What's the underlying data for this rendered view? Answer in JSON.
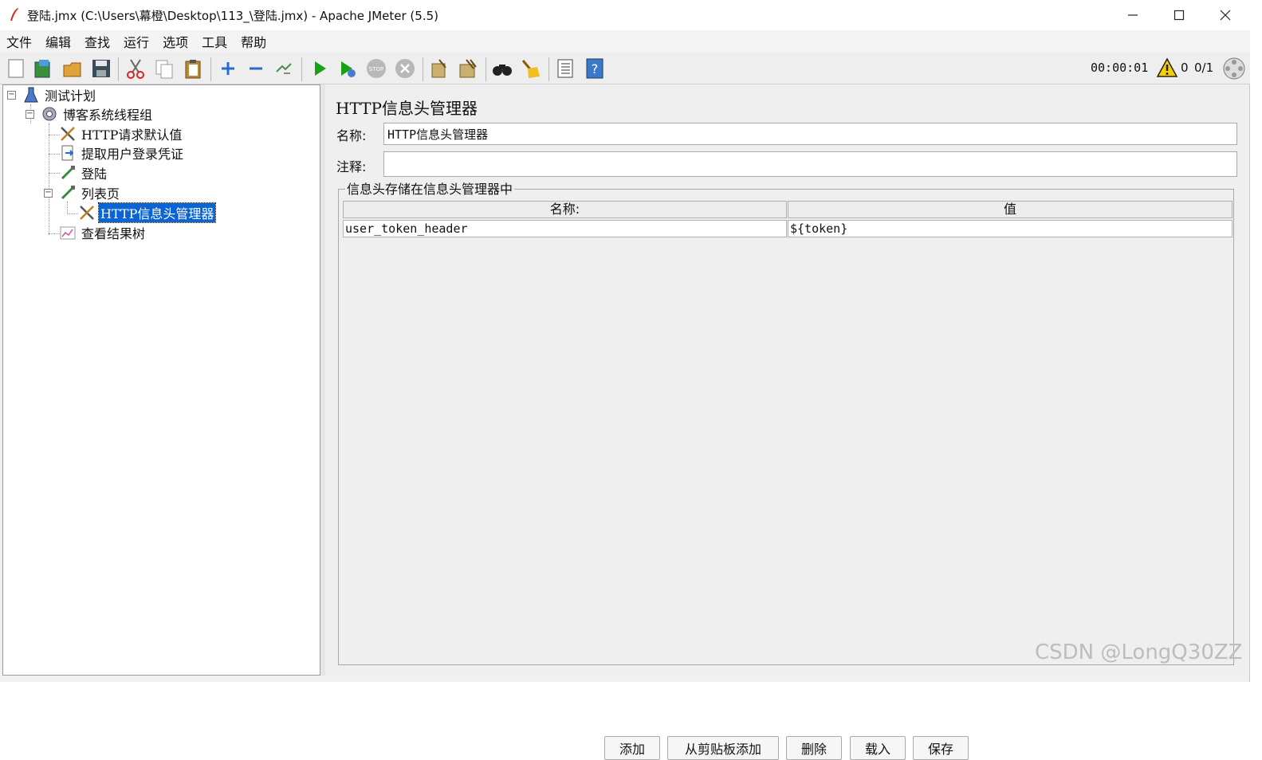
{
  "window": {
    "title": "登陆.jmx (C:\\Users\\幕橙\\Desktop\\113_\\登陆.jmx) - Apache JMeter (5.5)"
  },
  "menu": [
    "文件",
    "编辑",
    "查找",
    "运行",
    "选项",
    "工具",
    "帮助"
  ],
  "toolbar": {
    "timer": "00:00:01",
    "warning_count": "0",
    "thread_count": "0/1",
    "icons": [
      "new-icon",
      "templates-icon",
      "open-icon",
      "save-icon",
      "cut-icon",
      "copy-icon",
      "paste-icon",
      "expand-icon",
      "collapse-icon",
      "toggle-icon",
      "start-icon",
      "start-no-pause-icon",
      "stop-icon",
      "shutdown-icon",
      "clear-icon",
      "clear-all-icon",
      "search-icon",
      "reset-search-icon",
      "function-helper-icon",
      "help-icon"
    ]
  },
  "tree": {
    "items": [
      {
        "label": "测试计划",
        "icon": "test-plan-icon"
      },
      {
        "label": "博客系统线程组",
        "icon": "thread-group-icon"
      },
      {
        "label": "HTTP请求默认值",
        "icon": "config-tools-icon"
      },
      {
        "label": "提取用户登录凭证",
        "icon": "extractor-icon"
      },
      {
        "label": "登陆",
        "icon": "sampler-icon"
      },
      {
        "label": "列表页",
        "icon": "sampler-icon"
      },
      {
        "label": "HTTP信息头管理器",
        "icon": "config-tools-icon"
      },
      {
        "label": "查看结果树",
        "icon": "listener-icon"
      }
    ]
  },
  "editor": {
    "title": "HTTP信息头管理器",
    "name_label": "名称:",
    "name_value": "HTTP信息头管理器",
    "comment_label": "注释:",
    "comment_value": "",
    "group_title": "信息头存储在信息头管理器中",
    "table": {
      "headers": [
        "名称:",
        "值"
      ],
      "rows": [
        [
          "user_token_header",
          "${token}"
        ]
      ]
    },
    "buttons": {
      "add": "添加",
      "add_from_clipboard": "从剪贴板添加",
      "delete": "删除",
      "load": "载入",
      "save": "保存"
    }
  },
  "watermark": "CSDN @LongQ30ZZ"
}
